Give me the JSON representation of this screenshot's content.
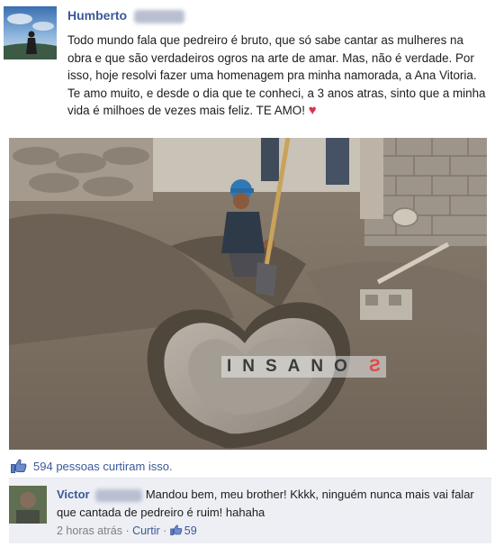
{
  "post": {
    "author": "Humberto",
    "text": "Todo mundo fala que pedreiro é bruto, que só sabe cantar as mulheres na obra e que são verdadeiros ogros na arte de amar. Mas, não é verdade. Por isso, hoje resolvi fazer uma homenagem pra minha namorada, a Ana Vitoria. Te amo muito, e desde o dia que te conheci, a 3 anos atras, sinto que a minha vida é milhoes de vezes mais feliz. TE AMO!",
    "heart_icon": "heart-emoji",
    "watermark_main": "INSANO",
    "watermark_end": "S"
  },
  "likes": {
    "icon": "thumbs-up-icon",
    "count": "594",
    "label": " pessoas curtiram isso."
  },
  "comment": {
    "author": "Victor",
    "text": " Mandou bem, meu brother! Kkkk, ninguém nunca mais vai falar que cantada de pedreiro é ruim! hahaha",
    "time": "2 horas atrás",
    "sep": " · ",
    "like_link": "Curtir",
    "sep2": " · ",
    "like_count": "59"
  },
  "colors": {
    "link": "#3b5998",
    "comment_bg": "#edeff4",
    "heart": "#d9334b"
  }
}
